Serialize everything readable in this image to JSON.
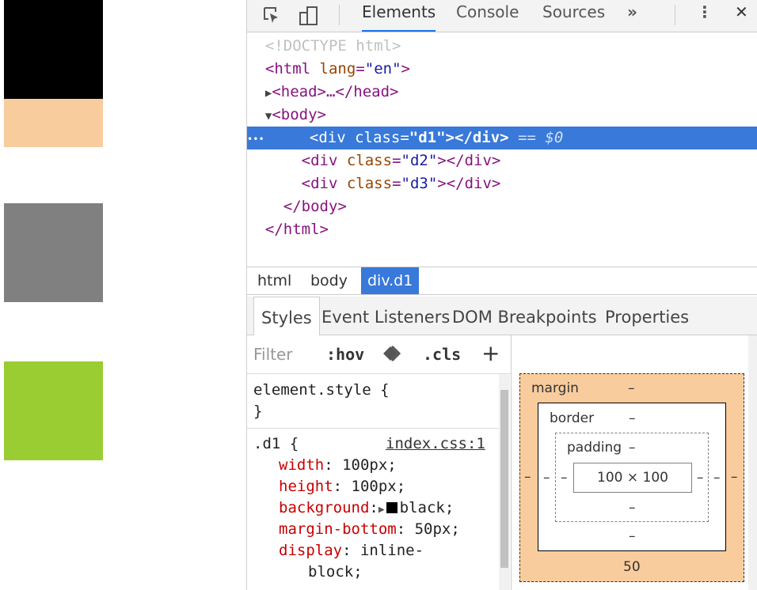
{
  "toolbar": {
    "tabs": [
      "Elements",
      "Console",
      "Sources"
    ],
    "more": "»",
    "menu": "⋮",
    "close": "✕"
  },
  "dom": {
    "doctype": "<!DOCTYPE html>",
    "html_open_tag": "<html",
    "html_attr": "lang",
    "html_val": "\"en\"",
    "head_line": "<head>…</head>",
    "body_open": "<body>",
    "divs": [
      {
        "class_val": "\"d1\""
      },
      {
        "class_val": "\"d2\""
      },
      {
        "class_val": "\"d3\""
      }
    ],
    "div_open": "<div",
    "div_attr": "class",
    "div_close": "></div>",
    "selected_marker": "== $0",
    "ellipsis": "•••",
    "body_close": "</body>",
    "html_close": "</html>"
  },
  "breadcrumbs": [
    "html",
    "body",
    "div.d1"
  ],
  "subtabs": [
    "Styles",
    "Event Listeners",
    "DOM Breakpoints",
    "Properties"
  ],
  "filter": {
    "placeholder": "Filter",
    "hov": ":hov",
    "cls": ".cls",
    "add": "+"
  },
  "rules": {
    "element_style": "element.style {",
    "close_brace": "}",
    "selector": ".d1 {",
    "source": "index.css:1",
    "props": [
      {
        "name": "width",
        "value": " 100px;"
      },
      {
        "name": "height",
        "value": " 100px;"
      },
      {
        "name": "background",
        "value": "black;"
      },
      {
        "name": "margin-bottom",
        "value": " 50px;"
      },
      {
        "name": "display",
        "value": " inline-"
      }
    ],
    "wrap": "block;"
  },
  "boxmodel": {
    "margin_label": "margin",
    "border_label": "border",
    "padding_label": "padding",
    "content": "100 × 100",
    "dash": "–",
    "margin_bottom": "50"
  },
  "colors": {
    "d1": "#000000",
    "d2": "#808080",
    "d3": "#9acd32",
    "margin": "#f9cc9d",
    "selection": "#3879d9"
  }
}
